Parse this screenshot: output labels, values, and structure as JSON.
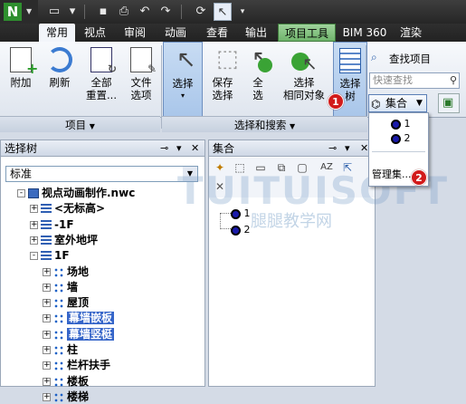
{
  "quick_access": {
    "items": [
      "new-file-icon",
      "open-folder-icon",
      "save-icon",
      "print-icon",
      "undo-icon",
      "redo-icon",
      "refresh-icon",
      "select-cursor-icon",
      "customize-dropdown-icon"
    ]
  },
  "tabs": [
    "常用",
    "视点",
    "审阅",
    "动画",
    "查看",
    "输出",
    "项目工具",
    "BIM 360",
    "渲染"
  ],
  "ribbon": {
    "append": "附加",
    "refresh": "刷新",
    "reset_all_1": "全部",
    "reset_all_2": "重置...",
    "file_options_1": "文件",
    "file_options_2": "选项",
    "select_1": "选择",
    "save_selection_1": "保存",
    "save_selection_2": "选择",
    "select_all_1": "全",
    "select_all_2": "选",
    "select_same_1": "选择",
    "select_same_2": "相同对象",
    "selection_tree_1": "选择",
    "selection_tree_2": "树",
    "find_items": "查找项目",
    "quick_find_placeholder": "快速查找",
    "sets_label": "集合",
    "panel_project": "项目",
    "panel_select_search": "选择和搜索"
  },
  "sets_menu": {
    "items": [
      "1",
      "2"
    ],
    "manage": "管理集..."
  },
  "badges": [
    "1",
    "2"
  ],
  "left_panel": {
    "title": "选择树",
    "dropdown_value": "标准",
    "nodes": [
      {
        "label": "视点动画制作.nwc",
        "indent": 0,
        "expander": "-",
        "icon": "file",
        "bold": true
      },
      {
        "label": "<无标高>",
        "indent": 1,
        "expander": "+",
        "icon": "layer"
      },
      {
        "label": "-1F",
        "indent": 1,
        "expander": "+",
        "icon": "layer"
      },
      {
        "label": "室外地坪",
        "indent": 1,
        "expander": "+",
        "icon": "layer"
      },
      {
        "label": "1F",
        "indent": 1,
        "expander": "-",
        "icon": "layer"
      },
      {
        "label": "场地",
        "indent": 2,
        "expander": "+",
        "icon": "group"
      },
      {
        "label": "墙",
        "indent": 2,
        "expander": "+",
        "icon": "group"
      },
      {
        "label": "屋顶",
        "indent": 2,
        "expander": "+",
        "icon": "group"
      },
      {
        "label": "幕墙嵌板",
        "indent": 2,
        "expander": "+",
        "icon": "group",
        "highlight": true
      },
      {
        "label": "幕墙竖梃",
        "indent": 2,
        "expander": "+",
        "icon": "group",
        "highlight": true
      },
      {
        "label": "柱",
        "indent": 2,
        "expander": "+",
        "icon": "group"
      },
      {
        "label": "栏杆扶手",
        "indent": 2,
        "expander": "+",
        "icon": "group"
      },
      {
        "label": "楼板",
        "indent": 2,
        "expander": "+",
        "icon": "group"
      },
      {
        "label": "楼梯",
        "indent": 2,
        "expander": "+",
        "icon": "group"
      }
    ]
  },
  "right_panel": {
    "title": "集合",
    "sets": [
      "1",
      "2"
    ]
  },
  "watermark": {
    "logo": "TUITUISOFT",
    "text": "腿腿教学网"
  },
  "colors": {
    "tab_tool": "#6fb46b",
    "badge": "#d21b1b",
    "highlight": "#3565c9",
    "set_icon": "#1a1aaa"
  }
}
